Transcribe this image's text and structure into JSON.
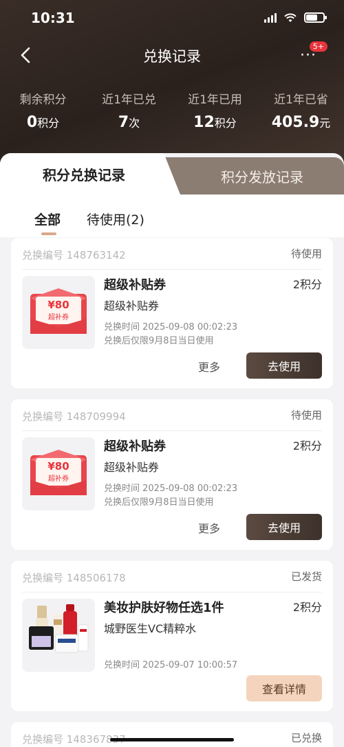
{
  "status_bar": {
    "time": "10:31"
  },
  "nav": {
    "title": "兑换记录",
    "more": "···",
    "badge": "5+"
  },
  "stats": [
    {
      "label": "剩余积分",
      "value": "0",
      "unit": "积分"
    },
    {
      "label": "近1年已兑",
      "value": "7",
      "unit": "次"
    },
    {
      "label": "近1年已用",
      "value": "12",
      "unit": "积分"
    },
    {
      "label": "近1年已省",
      "value": "405.9",
      "unit": "元"
    }
  ],
  "tabs": {
    "active": "积分兑换记录",
    "inactive": "积分发放记录"
  },
  "subtabs": {
    "all": "全部",
    "pending": "待使用(2)"
  },
  "coupon_art": {
    "amount": "¥80",
    "label": "超补券"
  },
  "cards": [
    {
      "order_no": "兑换编号 148763142",
      "status": "待使用",
      "title": "超级补贴券",
      "subtitle": "超级补贴券",
      "points": "2积分",
      "time": "兑换时间  2025-09-08 00:02:23",
      "note": "兑换后仅限9月8日当日使用",
      "more": "更多",
      "action": "去使用"
    },
    {
      "order_no": "兑换编号 148709994",
      "status": "待使用",
      "title": "超级补贴券",
      "subtitle": "超级补贴券",
      "points": "2积分",
      "time": "兑换时间  2025-09-08 00:02:23",
      "note": "兑换后仅限9月8日当日使用",
      "more": "更多",
      "action": "去使用"
    },
    {
      "order_no": "兑换编号 148506178",
      "status": "已发货",
      "title": "美妆护肤好物任选1件",
      "subtitle": "城野医生VC精粹水",
      "points": "2积分",
      "time": "兑换时间  2025-09-07 10:00:57",
      "action": "查看详情"
    },
    {
      "order_no": "兑换编号 148367837",
      "status": "已兑换"
    }
  ]
}
